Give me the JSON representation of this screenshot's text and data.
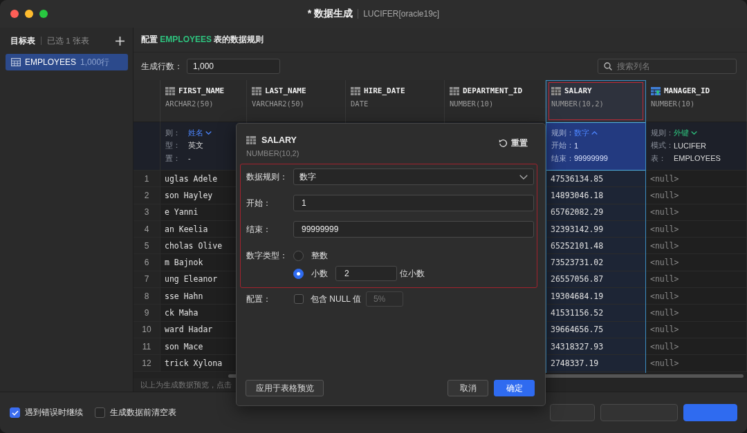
{
  "window": {
    "title": "* 数据生成",
    "connection": "LUCIFER[oracle19c]"
  },
  "sidebar": {
    "title": "目标表",
    "summary": "已选 1 张表",
    "items": [
      {
        "name": "EMPLOYEES",
        "rows": "1,000行",
        "selected": true
      }
    ]
  },
  "config": {
    "heading": {
      "prefix": "配置",
      "table": "EMPLOYEES",
      "suffix": "表的数据规则"
    },
    "row_count": {
      "label": "生成行数：",
      "value": "1,000"
    },
    "search": {
      "placeholder": "搜索列名"
    }
  },
  "grid": {
    "row_numbers": [
      "1",
      "2",
      "3",
      "4",
      "5",
      "6",
      "7",
      "8",
      "9",
      "10",
      "11",
      "12"
    ],
    "columns": [
      {
        "name": "FIRST_NAME",
        "type": "ARCHAR2(50)",
        "kind": "column",
        "selected": false,
        "highlighted": false,
        "rule": [
          {
            "label": "则：",
            "value": "姓名",
            "kind": "choice",
            "expanded": false
          },
          {
            "label": "型：",
            "value": "英文",
            "kind": "plain"
          },
          {
            "label": "置：",
            "value": "-",
            "kind": "plain"
          }
        ],
        "values": [
          {
            "text": "uglas Adele",
            "null": false
          },
          {
            "text": "son Hayley",
            "null": false
          },
          {
            "text": "e Yanni",
            "null": false
          },
          {
            "text": "an Keelia",
            "null": false
          },
          {
            "text": "cholas Olive",
            "null": false
          },
          {
            "text": "m Bajnok",
            "null": false
          },
          {
            "text": "ung Eleanor",
            "null": false
          },
          {
            "text": "sse Hahn",
            "null": false
          },
          {
            "text": "ck Maha",
            "null": false
          },
          {
            "text": "ward Hadar",
            "null": false
          },
          {
            "text": "son Mace",
            "null": false
          },
          {
            "text": "trick Xylona",
            "null": false
          }
        ]
      },
      {
        "name": "LAST_NAME",
        "type": "VARCHAR2(50)",
        "kind": "column",
        "selected": false,
        "highlighted": false
      },
      {
        "name": "HIRE_DATE",
        "type": "DATE",
        "kind": "column",
        "selected": false,
        "highlighted": false
      },
      {
        "name": "DEPARTMENT_ID",
        "type": "NUMBER(10)",
        "kind": "column",
        "selected": false,
        "highlighted": false
      },
      {
        "name": "SALARY",
        "type": "NUMBER(10,2)",
        "kind": "column",
        "selected": true,
        "highlighted": true,
        "rule": [
          {
            "label": "规则：",
            "value": "数字",
            "kind": "choice",
            "expanded": true
          },
          {
            "label": "开始：",
            "value": "1",
            "kind": "plain"
          },
          {
            "label": "结束：",
            "value": "99999999",
            "kind": "plain"
          }
        ],
        "values": [
          {
            "text": "47536134.85",
            "null": false
          },
          {
            "text": "14893046.18",
            "null": false
          },
          {
            "text": "65762082.29",
            "null": false
          },
          {
            "text": "32393142.99",
            "null": false
          },
          {
            "text": "65252101.48",
            "null": false
          },
          {
            "text": "73523731.02",
            "null": false
          },
          {
            "text": "26557056.87",
            "null": false
          },
          {
            "text": "19304684.19",
            "null": false
          },
          {
            "text": "41531156.52",
            "null": false
          },
          {
            "text": "39664656.75",
            "null": false
          },
          {
            "text": "34318327.93",
            "null": false
          },
          {
            "text": "2748337.19",
            "null": false
          }
        ]
      },
      {
        "name": "MANAGER_ID",
        "type": "NUMBER(10)",
        "kind": "foreign_key",
        "selected": false,
        "highlighted": false,
        "rule": [
          {
            "label": "规则：",
            "value": "外键",
            "kind": "choice",
            "expanded": false
          },
          {
            "label": "模式：",
            "value": "LUCIFER",
            "kind": "plain"
          },
          {
            "label": "表：",
            "value": "EMPLOYEES",
            "kind": "plain"
          }
        ],
        "values": [
          {
            "text": "<null>",
            "null": true
          },
          {
            "text": "<null>",
            "null": true
          },
          {
            "text": "<null>",
            "null": true
          },
          {
            "text": "<null>",
            "null": true
          },
          {
            "text": "<null>",
            "null": true
          },
          {
            "text": "<null>",
            "null": true
          },
          {
            "text": "<null>",
            "null": true
          },
          {
            "text": "<null>",
            "null": true
          },
          {
            "text": "<null>",
            "null": true
          },
          {
            "text": "<null>",
            "null": true
          },
          {
            "text": "<null>",
            "null": true
          },
          {
            "text": "<null>",
            "null": true
          }
        ]
      }
    ],
    "note": "以上为生成数据预览，点击"
  },
  "dialog": {
    "title": "SALARY",
    "type": "NUMBER(10,2)",
    "reset": "重置",
    "highlighted": true,
    "fields": [
      {
        "kind": "select",
        "label": "数据规则：",
        "value": "数字"
      },
      {
        "kind": "input",
        "label": "开始：",
        "value": "1"
      },
      {
        "kind": "input",
        "label": "结束：",
        "value": "99999999"
      },
      {
        "kind": "radio",
        "label": "数字类型：",
        "options": [
          {
            "label": "整数",
            "selected": false
          },
          {
            "label": "小数",
            "selected": true,
            "digits": "2",
            "unit": "位小数"
          }
        ]
      }
    ],
    "null_option": {
      "label": "配置：",
      "text": "包含 NULL 值",
      "checked": false,
      "percent": "5%",
      "percent_disabled": true
    },
    "buttons": [
      {
        "label": "应用于表格预览",
        "kind": "secondary"
      },
      {
        "label": "取消",
        "kind": "secondary"
      },
      {
        "label": "确定",
        "kind": "primary"
      }
    ]
  },
  "bottom_bar": {
    "options": [
      {
        "label": "遇到错误时继续",
        "checked": true
      },
      {
        "label": "生成数据前清空表",
        "checked": false
      }
    ],
    "buttons": [
      {
        "kind": "secondary"
      },
      {
        "kind": "secondary"
      },
      {
        "kind": "primary"
      }
    ]
  }
}
